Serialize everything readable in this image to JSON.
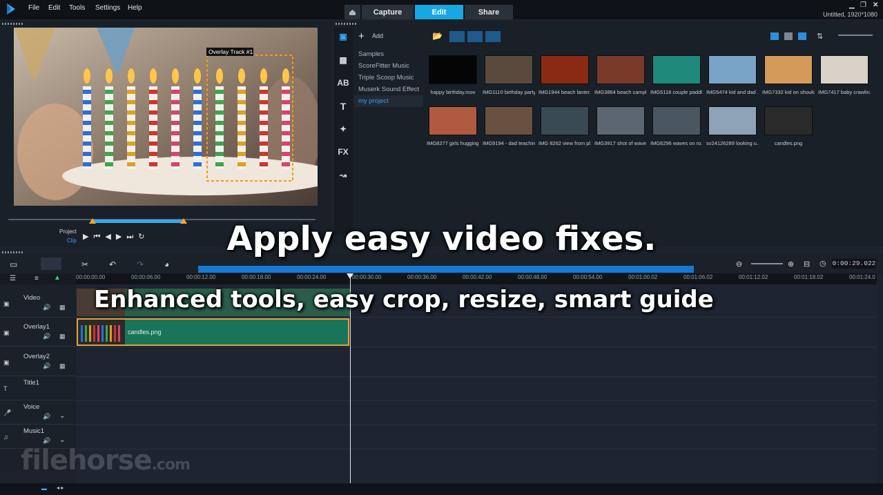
{
  "menubar": {
    "items": [
      "File",
      "Edit",
      "Tools",
      "Settings",
      "Help"
    ],
    "tabs": [
      {
        "label": "Capture"
      },
      {
        "label": "Edit"
      },
      {
        "label": "Share"
      }
    ],
    "project_info": "Untitled, 1920*1080"
  },
  "preview": {
    "overlay_label": "Overlay Track #1",
    "project_label": "Project",
    "clip_label": "Clip"
  },
  "library": {
    "add_label": "Add",
    "folders": [
      "Samples",
      "ScoreFitter Music",
      "Triple Scoop Music",
      "Muserk Sound Effect",
      "my project"
    ],
    "selected_folder": "my project",
    "media": [
      {
        "label": "happy birthday.mov",
        "color": "#050505"
      },
      {
        "label": "IMG1110 birthday party...",
        "color": "#5a4a3e"
      },
      {
        "label": "IMG1944 beach lanter...",
        "color": "#8a2a12"
      },
      {
        "label": "IMG3864 beach campl...",
        "color": "#7a3a2a"
      },
      {
        "label": "IMG5118 couple paddl...",
        "color": "#1f8a7c"
      },
      {
        "label": "IMG5474 kid and dad ...",
        "color": "#7aa3c8"
      },
      {
        "label": "IMG7332 kid on should...",
        "color": "#d49a5a"
      },
      {
        "label": "IMG7417 baby crawlin...",
        "color": "#d8d2c8"
      },
      {
        "label": "IMG8277 girls hugging...",
        "color": "#b05a40"
      },
      {
        "label": "IMG9194 - dad teachin...",
        "color": "#6a5040"
      },
      {
        "label": "IMG 8262 view from pl...",
        "color": "#3a4a55"
      },
      {
        "label": "IMG3917 shot of wave...",
        "color": "#5c6670"
      },
      {
        "label": "IMG6296 waves on ro...",
        "color": "#4a5660"
      },
      {
        "label": "sv24126289 looking u...",
        "color": "#8fa3b8"
      },
      {
        "label": "candles.png",
        "color": "#2a2a2a"
      }
    ]
  },
  "timeline": {
    "timecode": "0:00:29.022",
    "ruler_ticks": [
      "00:00:00.00",
      "00:00:06.00",
      "00:00:12.00",
      "00:00:18.00",
      "00:00:24.00",
      "00:00:30.00",
      "00:00:36.00",
      "00:00:42.00",
      "00:00:48.00",
      "00:00:54.00",
      "00:01:00.02",
      "00:01:06.02",
      "00:01:12.02",
      "00:01:18.02",
      "00:01:24.0"
    ],
    "tracks": [
      "Video",
      "Overlay1",
      "Overlay2",
      "Title1",
      "Voice",
      "Music1"
    ],
    "clip_label": "candles.png"
  },
  "captions": {
    "headline": "Apply easy video fixes.",
    "subline": "Enhanced tools, easy crop, resize, smart guide"
  },
  "watermark": {
    "brand": "filehorse",
    "suffix": ".com"
  }
}
